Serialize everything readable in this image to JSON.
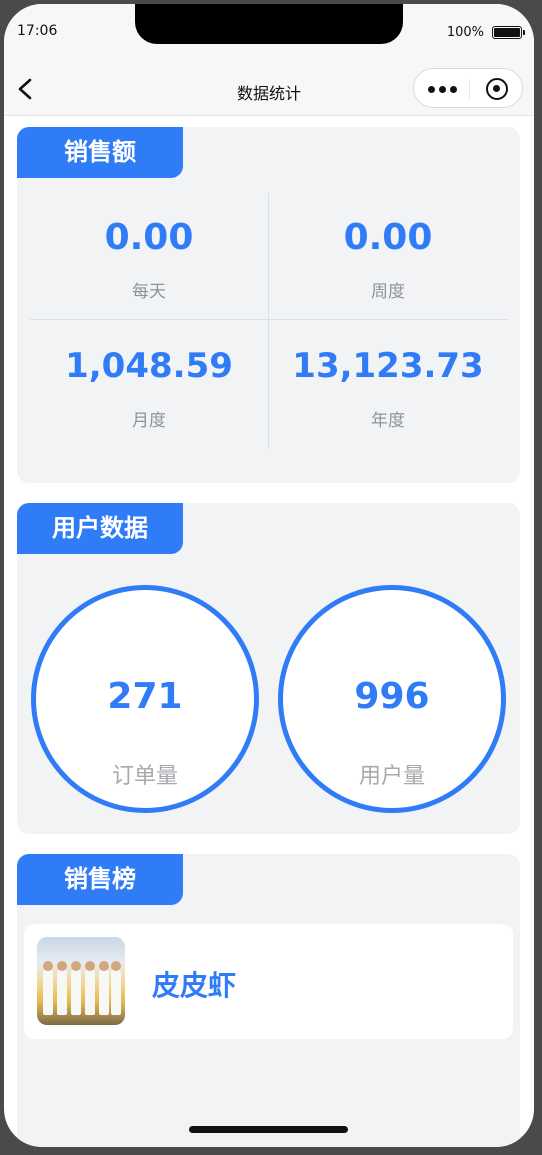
{
  "status_bar": {
    "time": "17:06",
    "battery_text": "100%"
  },
  "navbar": {
    "title": "数据统计"
  },
  "sales": {
    "tag": "销售额",
    "daily": {
      "value": "0.00",
      "label": "每天"
    },
    "weekly": {
      "value": "0.00",
      "label": "周度"
    },
    "monthly": {
      "value": "1,048.59",
      "label": "月度"
    },
    "yearly": {
      "value": "13,123.73",
      "label": "年度"
    }
  },
  "user_data": {
    "tag": "用户数据",
    "orders": {
      "value": "271",
      "label": "订单量"
    },
    "users": {
      "value": "996",
      "label": "用户量"
    }
  },
  "ranking": {
    "tag": "销售榜",
    "items": [
      {
        "name": "皮皮虾"
      }
    ]
  },
  "colors": {
    "accent": "#2f7cf6",
    "card_bg": "#f2f3f5",
    "muted_text": "#8f9399"
  }
}
